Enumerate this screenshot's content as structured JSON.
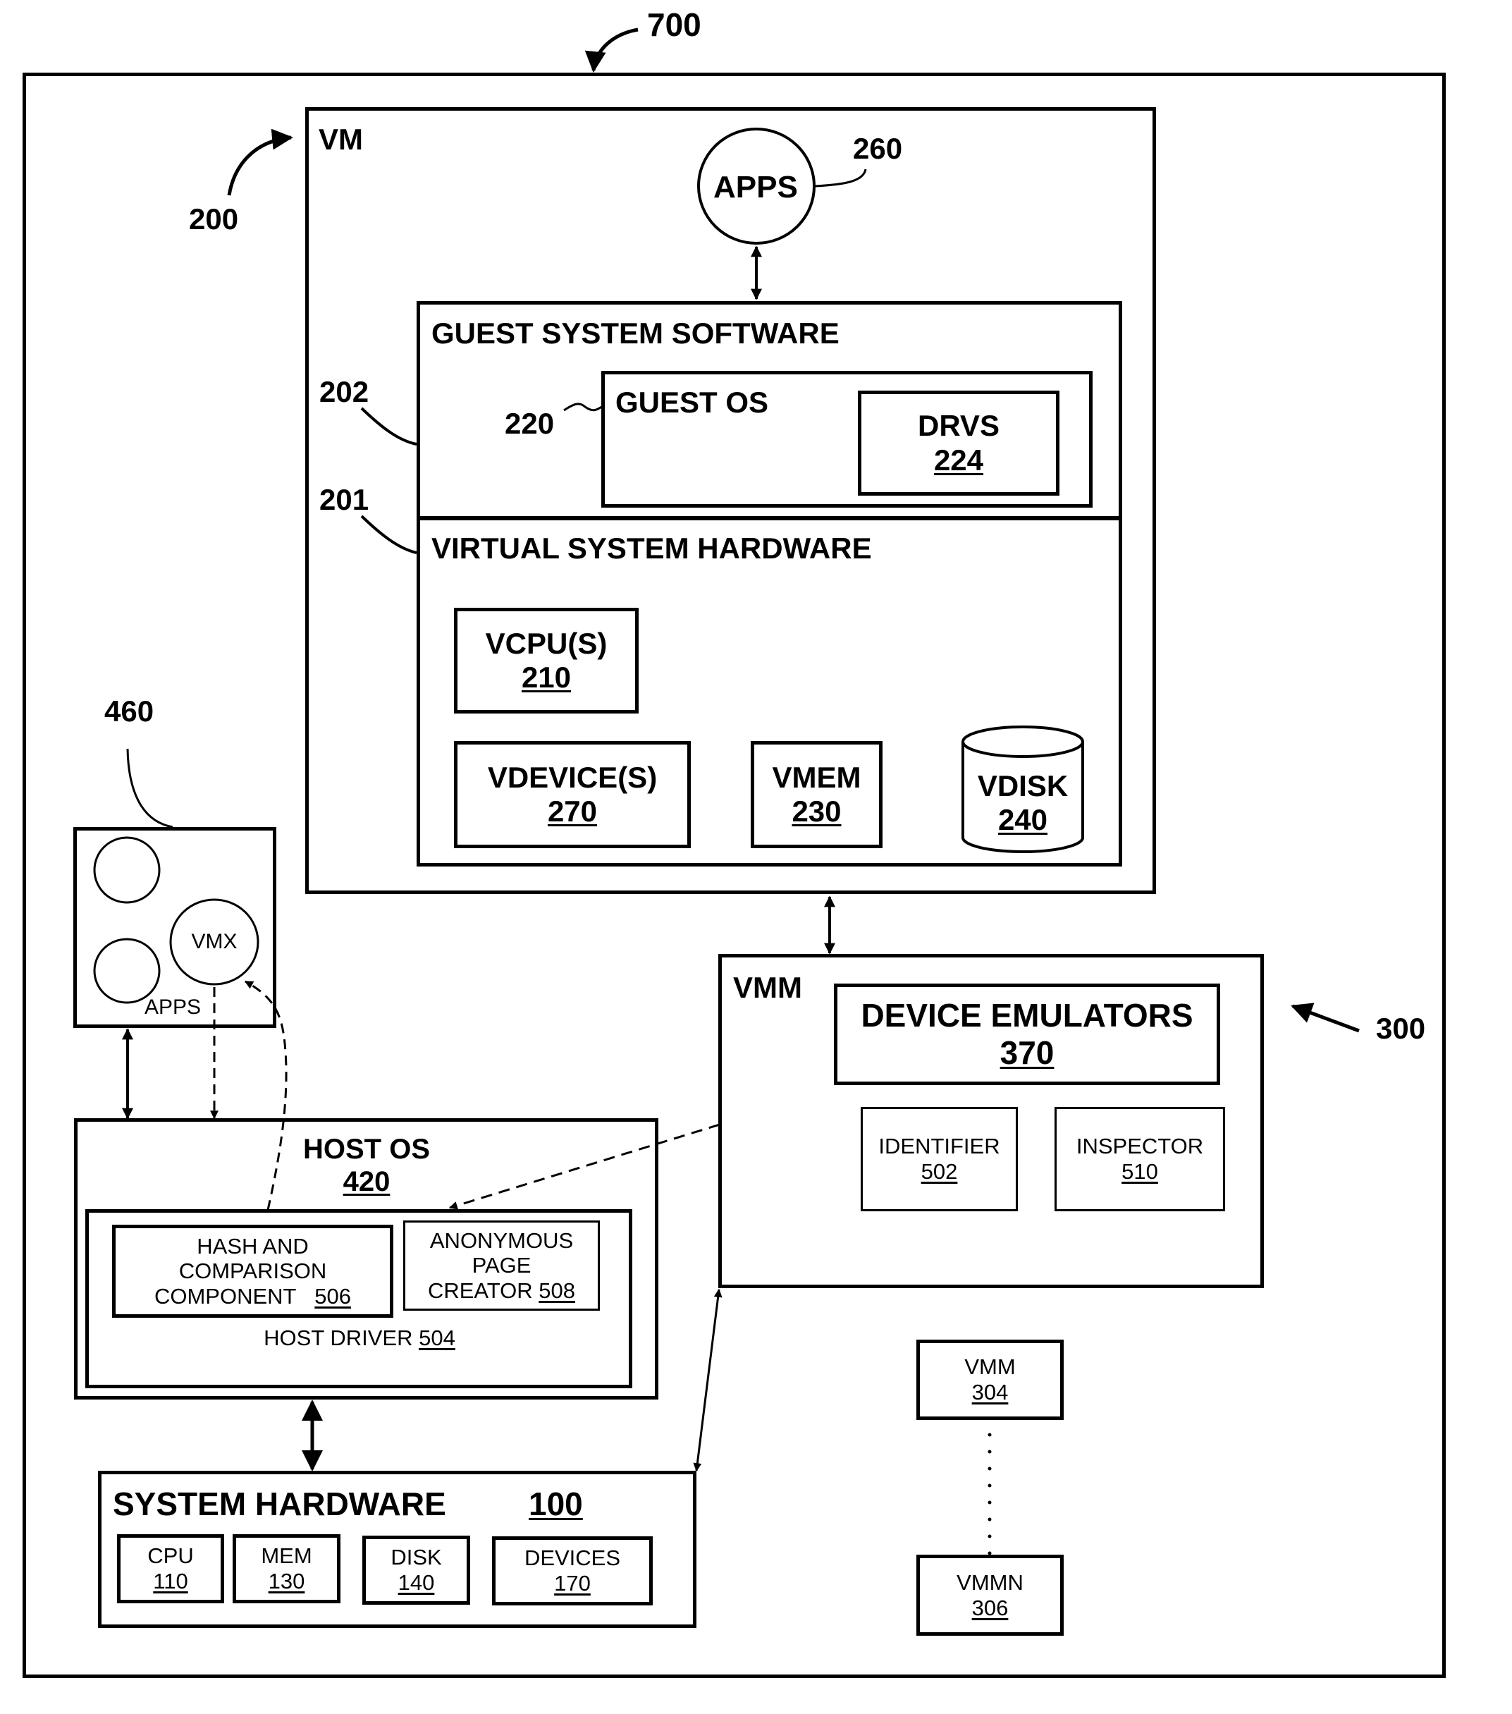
{
  "figure": {
    "ref_700": "700",
    "ref_200": "200",
    "ref_202": "202",
    "ref_201": "201",
    "ref_220": "220",
    "ref_260": "260",
    "ref_460": "460",
    "ref_300": "300"
  },
  "vm": {
    "title": "VM",
    "apps": "APPS",
    "guest_system_software": "GUEST SYSTEM SOFTWARE",
    "guest_os": "GUEST OS",
    "drvs": {
      "label": "DRVS",
      "num": "224"
    },
    "virtual_system_hardware": "VIRTUAL SYSTEM HARDWARE",
    "vcpu": {
      "label": "VCPU(S)",
      "num": "210"
    },
    "vdevice": {
      "label": "VDEVICE(S)",
      "num": "270"
    },
    "vmem": {
      "label": "VMEM",
      "num": "230"
    },
    "vdisk": {
      "label": "VDISK",
      "num": "240"
    }
  },
  "apps_box": {
    "vmx": "VMX",
    "apps": "APPS"
  },
  "host_os": {
    "title": "HOST OS",
    "num": "420",
    "hash": {
      "line1": "HASH AND",
      "line2": "COMPARISON",
      "line3": "COMPONENT",
      "num": "506"
    },
    "anon": {
      "line1": "ANONYMOUS",
      "line2": "PAGE",
      "line3": "CREATOR",
      "num": "508"
    },
    "driver": {
      "label": "HOST DRIVER",
      "num": "504"
    }
  },
  "system_hardware": {
    "title": "SYSTEM HARDWARE",
    "num": "100",
    "cpu": {
      "label": "CPU",
      "num": "110"
    },
    "mem": {
      "label": "MEM",
      "num": "130"
    },
    "disk": {
      "label": "DISK",
      "num": "140"
    },
    "devices": {
      "label": "DEVICES",
      "num": "170"
    }
  },
  "vmm": {
    "title": "VMM",
    "device_emulators": {
      "label": "DEVICE EMULATORS",
      "num": "370"
    },
    "identifier": {
      "label": "IDENTIFIER",
      "num": "502"
    },
    "inspector": {
      "label": "INSPECTOR",
      "num": "510"
    }
  },
  "vmm_304": {
    "label": "VMM",
    "num": "304"
  },
  "vmm_306": {
    "label": "VMMN",
    "num": "306"
  }
}
